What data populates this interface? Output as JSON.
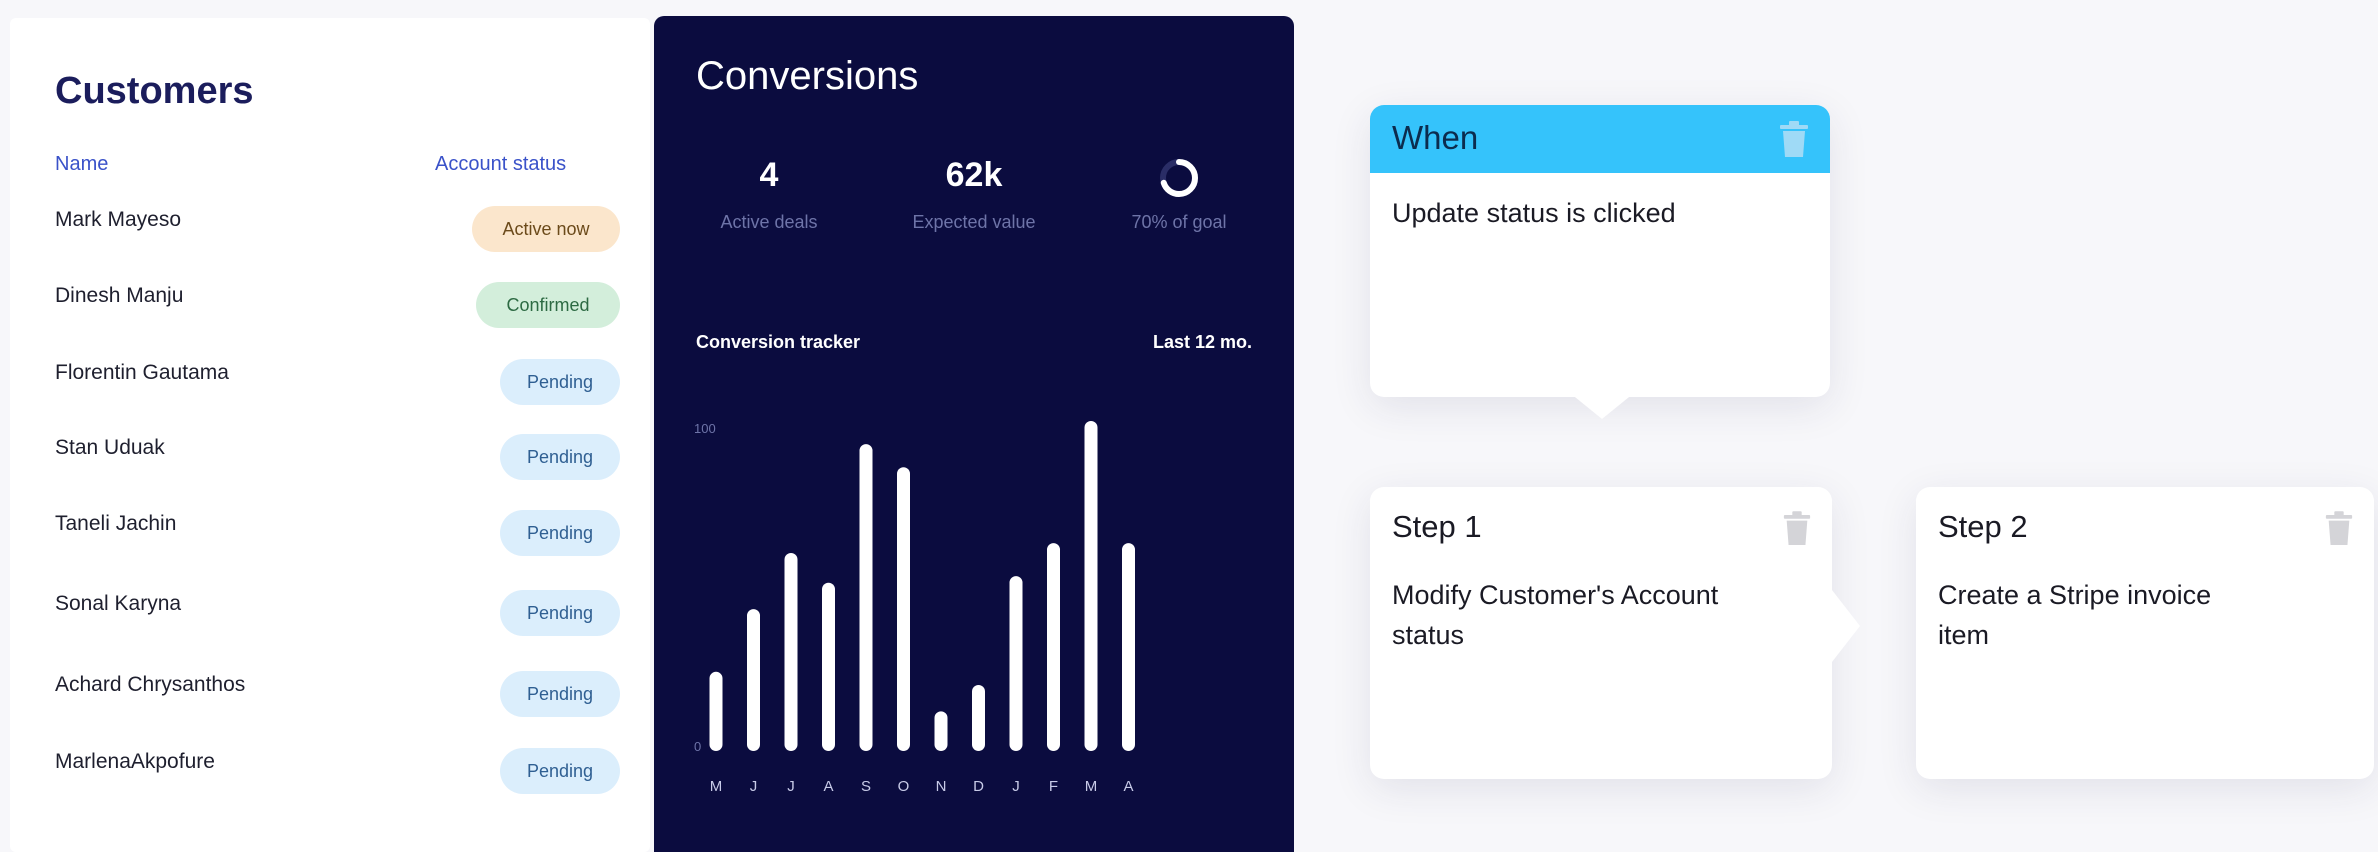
{
  "customers": {
    "title": "Customers",
    "columns": {
      "name": "Name",
      "status": "Account status"
    },
    "rows": [
      {
        "name": "Mark Mayeso",
        "status": "Active now",
        "kind": "active"
      },
      {
        "name": "Dinesh Manju",
        "status": "Confirmed",
        "kind": "confirmed"
      },
      {
        "name": "Florentin Gautama",
        "status": "Pending",
        "kind": "pending"
      },
      {
        "name": "Stan Uduak",
        "status": "Pending",
        "kind": "pending"
      },
      {
        "name": "Taneli Jachin",
        "status": "Pending",
        "kind": "pending"
      },
      {
        "name": "Sonal Karyna",
        "status": "Pending",
        "kind": "pending"
      },
      {
        "name": "Achard Chrysanthos",
        "status": "Pending",
        "kind": "pending"
      },
      {
        "name": "MarlenaAkpofure",
        "status": "Pending",
        "kind": "pending"
      }
    ]
  },
  "conversions": {
    "title": "Conversions",
    "stats": {
      "deals_value": "4",
      "deals_label": "Active deals",
      "expected_value": "62k",
      "expected_label": "Expected value",
      "goal_label": "70% of goal",
      "goal_fraction": 0.7
    },
    "tracker_label": "Conversion tracker",
    "tracker_range": "Last 12 mo."
  },
  "chart_data": {
    "type": "bar",
    "categories": [
      "M",
      "J",
      "J",
      "A",
      "S",
      "O",
      "N",
      "D",
      "J",
      "F",
      "M",
      "A"
    ],
    "values": [
      24,
      43,
      60,
      51,
      93,
      86,
      12,
      20,
      53,
      63,
      100,
      63
    ],
    "ylim": [
      0,
      100
    ],
    "y_ticks": [
      "0",
      "100"
    ],
    "grid": false,
    "bar_color": "#ffffff"
  },
  "workflow": {
    "when": {
      "title": "When",
      "body": "Update status is clicked"
    },
    "step1": {
      "title": "Step 1",
      "body": "Modify Customer's Account status"
    },
    "step2": {
      "title": "Step 2",
      "body": "Create a Stripe invoice item"
    }
  },
  "icons": {
    "trash": "trash-icon",
    "progress_ring": "progress-ring-icon"
  },
  "colors": {
    "when_header": "#35c3fb",
    "conversions_bg": "#0b0c3f",
    "active_badge": "#fbe6cc",
    "confirmed_badge": "#d3eedb",
    "pending_badge": "#dbeefc"
  }
}
